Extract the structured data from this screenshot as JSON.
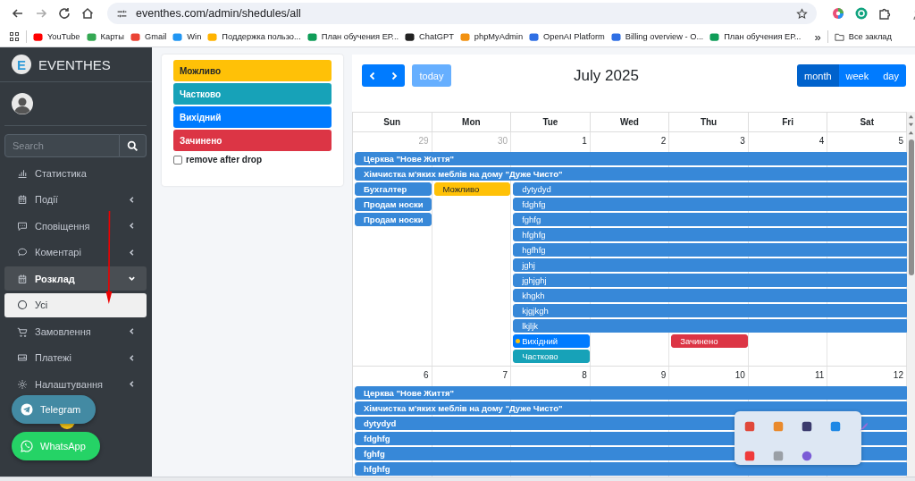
{
  "browser": {
    "url": "eventhes.com/admin/shedules/all",
    "bookmarks": [
      {
        "label": "YouTube"
      },
      {
        "label": "Карты"
      },
      {
        "label": "Gmail"
      },
      {
        "label": "Win"
      },
      {
        "label": "Поддержка пользо..."
      },
      {
        "label": "План обучения ЕР..."
      },
      {
        "label": "ChatGPT"
      },
      {
        "label": "phpMyAdmin"
      },
      {
        "label": "OpenAI Platform"
      },
      {
        "label": "Billing overview - O..."
      },
      {
        "label": "План обучения ЕР..."
      }
    ],
    "more": "»",
    "folder": "Все заклад"
  },
  "sidebar": {
    "brand_letter": "E",
    "brand": "EVENTHES",
    "search": {
      "placeholder": "Search"
    },
    "items": [
      {
        "label": "Статистика"
      },
      {
        "label": "Події",
        "expanded": false
      },
      {
        "label": "Сповіщення",
        "expanded": false
      },
      {
        "label": "Коментарі",
        "expanded": false
      },
      {
        "label": "Розклад",
        "expanded": true,
        "children": [
          {
            "label": "Усі",
            "selected": true
          }
        ]
      },
      {
        "label": "Замовлення",
        "expanded": false
      },
      {
        "label": "Платежі",
        "expanded": false
      },
      {
        "label": "Налаштування",
        "expanded": false
      }
    ]
  },
  "chat_buttons": [
    {
      "label": "Telegram",
      "color": "#438aa3"
    },
    {
      "label": "WhatsApp",
      "color": "#25d366"
    }
  ],
  "external_events": {
    "items": [
      {
        "label": "Можливо",
        "color": "#ffc107"
      },
      {
        "label": "Частково",
        "color": "#17a2b8"
      },
      {
        "label": "Вихідний",
        "color": "#007bff"
      },
      {
        "label": "Зачинено",
        "color": "#dc3545"
      }
    ],
    "remove_after_drop": {
      "label": "remove after drop",
      "checked": false
    }
  },
  "calendar": {
    "title": "July 2025",
    "today": {
      "label": "today",
      "disabled": true
    },
    "views": [
      {
        "label": "month",
        "selected": true
      },
      {
        "label": "week",
        "selected": false
      },
      {
        "label": "day",
        "selected": false
      }
    ],
    "weekdays": [
      "Sun",
      "Mon",
      "Tue",
      "Wed",
      "Thu",
      "Fri",
      "Sat"
    ],
    "weeks": [
      {
        "days": [
          {
            "number": "29",
            "other_month": true,
            "events": [
              {
                "title": "Церква \"Нове Життя\"",
                "multi_day": true,
                "color": "#3788d8"
              },
              {
                "title": "Хімчистка м'яких меблів на дому \"Дуже Чисто\"",
                "multi_day": true,
                "color": "#3788d8"
              },
              {
                "title": "Бухгалтер",
                "multi_day": false,
                "color": "#3788d8"
              },
              {
                "title": "Продам носки",
                "multi_day": false,
                "color": "#3788d8"
              },
              {
                "title": "Продам носки",
                "multi_day": false,
                "color": "#3788d8"
              }
            ]
          },
          {
            "number": "30",
            "other_month": true,
            "events": [
              {
                "title": "Можливо",
                "multi_day": false,
                "color": "#ffc107"
              }
            ]
          },
          {
            "number": "1",
            "other_month": false,
            "events": [
              {
                "title": "dytydyd",
                "multi_day": true,
                "color": "#3788d8"
              },
              {
                "title": "fdghfg",
                "multi_day": true,
                "color": "#3788d8"
              },
              {
                "title": "fghfg",
                "multi_day": true,
                "color": "#3788d8"
              },
              {
                "title": "hfghfg",
                "multi_day": true,
                "color": "#3788d8"
              },
              {
                "title": "hgfhfg",
                "multi_day": true,
                "color": "#3788d8"
              },
              {
                "title": "jghj",
                "multi_day": true,
                "color": "#3788d8"
              },
              {
                "title": "jghjghj",
                "multi_day": true,
                "color": "#3788d8"
              },
              {
                "title": "khgkh",
                "multi_day": true,
                "color": "#3788d8"
              },
              {
                "title": "kjgjkgh",
                "multi_day": true,
                "color": "#3788d8"
              },
              {
                "title": "lkjljk",
                "multi_day": true,
                "color": "#3788d8"
              },
              {
                "title": "Вихідний",
                "multi_day": false,
                "color": "#007bff",
                "marker": {
                  "color": "#ffc107"
                }
              },
              {
                "title": "Частково",
                "multi_day": false,
                "color": "#17a2b8"
              }
            ]
          },
          {
            "number": "2",
            "other_month": false
          },
          {
            "number": "3",
            "other_month": false,
            "events": [
              {
                "title": "Зачинено",
                "multi_day": false,
                "color": "#dc3545"
              }
            ]
          },
          {
            "number": "4",
            "other_month": false
          },
          {
            "number": "5",
            "other_month": false
          }
        ]
      },
      {
        "days": [
          {
            "number": "6",
            "other_month": false,
            "events": [
              {
                "title": "Церква \"Нове Життя\"",
                "multi_day": true,
                "color": "#3788d8"
              },
              {
                "title": "Хімчистка м'яких меблів на дому \"Дуже Чисто\"",
                "multi_day": true,
                "color": "#3788d8"
              },
              {
                "title": "dytydyd",
                "multi_day": true,
                "color": "#3788d8"
              },
              {
                "title": "fdghfg",
                "multi_day": true,
                "color": "#3788d8"
              },
              {
                "title": "fghfg",
                "multi_day": true,
                "color": "#3788d8"
              },
              {
                "title": "hfghfg",
                "multi_day": true,
                "color": "#3788d8"
              }
            ]
          },
          {
            "number": "7",
            "other_month": false
          },
          {
            "number": "8",
            "other_month": false
          },
          {
            "number": "9",
            "other_month": false
          },
          {
            "number": "10",
            "other_month": false
          },
          {
            "number": "11",
            "other_month": false
          },
          {
            "number": "12",
            "other_month": false
          }
        ]
      }
    ]
  }
}
